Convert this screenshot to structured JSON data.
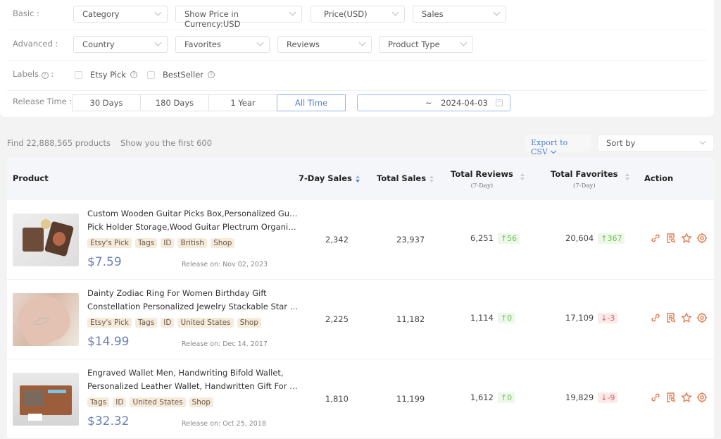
{
  "filters": {
    "basic": {
      "label": "Basic :",
      "selects": [
        "Category",
        "Show Price in Currency:USD",
        "Price(USD)",
        "Sales"
      ]
    },
    "advanced": {
      "label": "Advanced :",
      "selects": [
        "Country",
        "Favorites",
        "Reviews",
        "Product Type"
      ]
    },
    "labels": {
      "label": "Labels",
      "label_suffix": ":",
      "help_glyph": "?",
      "checkboxes": [
        {
          "label": "Etsy Pick",
          "checked": false
        },
        {
          "label": "BestSeller",
          "checked": false
        }
      ]
    },
    "release_time": {
      "label": "Release Time :",
      "options": [
        "30 Days",
        "180 Days",
        "1 Year",
        "All Time"
      ],
      "active": "All Time",
      "date_start": "",
      "date_separator": "~",
      "date_end": "2024-04-03"
    }
  },
  "summary": {
    "found": "Find 22,888,565 products",
    "showing": "Show you the first 600"
  },
  "toolbar": {
    "export_label": "Export to CSV",
    "sort_placeholder": "Sort by"
  },
  "table": {
    "columns": {
      "product": "Product",
      "sales_7d": "7-Day Sales",
      "total_sales": "Total Sales",
      "total_reviews": "Total Reviews",
      "total_reviews_sub": "(7-Day)",
      "total_favorites": "Total Favorites",
      "total_favorites_sub": "(7-Day)",
      "action": "Action"
    },
    "rows": [
      {
        "title_line1": "Custom Wooden Guitar Picks Box,Personalized Guitar",
        "title_line2": "Pick Holder Storage,Wood Guitar Plectrum Organizer...",
        "tags": [
          "Etsy's Pick",
          "Tags",
          "ID",
          "British",
          "Shop"
        ],
        "price": "$7.59",
        "release": "Release on: Nov 02, 2023",
        "sales_7d": "2,342",
        "total_sales": "23,937",
        "reviews": "6,251",
        "reviews_delta": "↑56",
        "reviews_dir": "up",
        "favorites": "20,604",
        "favorites_delta": "↑367",
        "favorites_dir": "up"
      },
      {
        "title_line1": "Dainty Zodiac Ring For Women Birthday Gift",
        "title_line2": "Constellation Personalized Jewelry Stackable Star Rin...",
        "tags": [
          "Etsy's Pick",
          "Tags",
          "ID",
          "United States",
          "Shop"
        ],
        "price": "$14.99",
        "release": "Release on: Dec 14, 2017",
        "sales_7d": "2,225",
        "total_sales": "11,182",
        "reviews": "1,114",
        "reviews_delta": "↑0",
        "reviews_dir": "up",
        "favorites": "17,109",
        "favorites_delta": "↓-3",
        "favorites_dir": "down"
      },
      {
        "title_line1": "Engraved Wallet Men, Handwriting Bifold Wallet,",
        "title_line2": "Personalized Leather Wallet, Handwritten Gift For Hi...",
        "tags": [
          "Tags",
          "ID",
          "United States",
          "Shop"
        ],
        "price": "$32.32",
        "release": "Release on: Oct 25, 2018",
        "sales_7d": "1,810",
        "total_sales": "11,199",
        "reviews": "1,612",
        "reviews_delta": "↑0",
        "reviews_dir": "up",
        "favorites": "19,829",
        "favorites_delta": "↓-9",
        "favorites_dir": "down"
      }
    ],
    "row_actions": [
      "link-icon",
      "report-search-icon",
      "star-icon",
      "target-icon"
    ]
  },
  "colors": {
    "accent_blue": "#4a7fdb",
    "price": "#6b7fb8",
    "action_orange": "#e27a4a",
    "up_green": "#6bbf55",
    "down_red": "#e05a5a",
    "tag_bg": "#f6eadb"
  }
}
